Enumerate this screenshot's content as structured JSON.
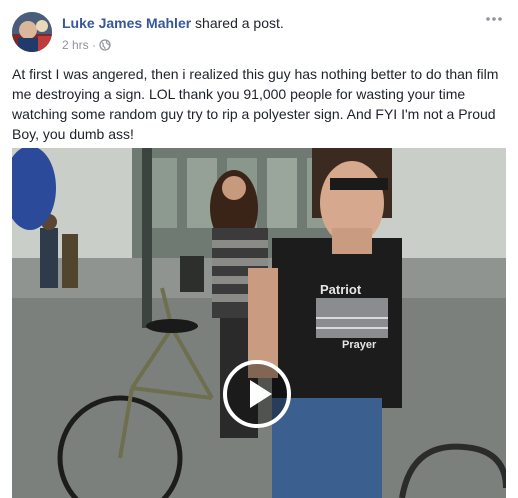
{
  "post": {
    "author": "Luke James Mahler",
    "action": " shared a post.",
    "time": "2 hrs",
    "separator": " · ",
    "privacy_icon": "globe-icon",
    "more_icon": "more-options-icon",
    "text": "At first I was angered, then i realized this guy has nothing better to do than film me destroying a sign. LOL thank you 91,000 people for wasting your time watching some random guy try to rip a polyester sign. And FYI I'm not a Proud Boy, you dumb ass!"
  },
  "video": {
    "shirt_text_line1": "Patriot",
    "shirt_text_line2": "Prayer",
    "play_icon": "play-icon"
  },
  "colors": {
    "link": "#365899",
    "meta": "#90949c",
    "text": "#1d2129"
  }
}
